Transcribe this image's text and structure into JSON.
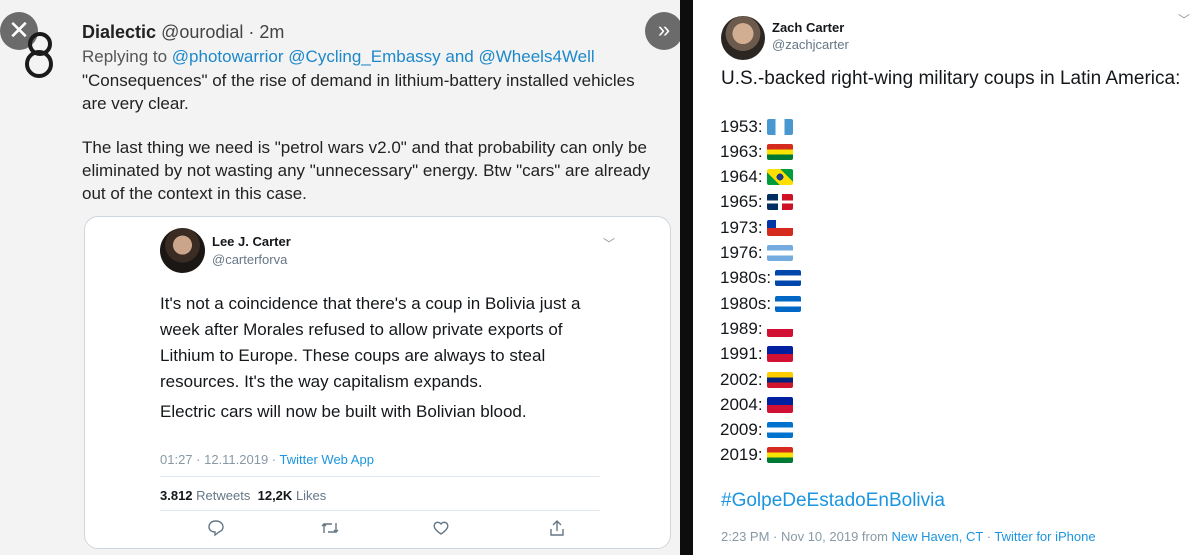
{
  "left_tweet": {
    "author_name": "Dialectic",
    "author_handle": "@ourodial",
    "separator": "·",
    "time_ago": "2m",
    "replying_prefix": "Replying to",
    "reply_handle_1": "@photowarrior",
    "reply_handle_2": "@Cycling_Embassy",
    "reply_and": "and",
    "reply_handle_3": "@Wheels4Well",
    "text_lines": [
      "\"Consequences\" of the rise of demand in lithium-battery installed vehicles",
      "are very clear.",
      "The last thing we need is \"petrol wars v2.0\" and that probability can only be",
      "eliminated by not wasting any \"unnecessary\" energy. Btw \"cars\" are already",
      "out of the context in this case."
    ],
    "close_icon": "close-icon",
    "next_icon": "double-chevron-right-icon"
  },
  "quoted_tweet": {
    "author_name": "Lee J. Carter",
    "author_handle": "@carterforva",
    "text_lines": [
      "It's not a coincidence that there's a coup in Bolivia just a",
      "week after Morales refused to allow private exports of",
      "Lithium to Europe.  These coups are always to steal",
      "resources.  It's the way capitalism expands.",
      "Electric cars will now be built with Bolivian blood."
    ],
    "timestamp": "01:27 · 12.11.2019 ·",
    "source": "Twitter Web App",
    "retweets_count": "3.812",
    "retweets_label": "Retweets",
    "likes_count": "12,2K",
    "likes_label": "Likes",
    "actions": [
      "reply-icon",
      "retweet-icon",
      "like-icon",
      "share-icon"
    ]
  },
  "right_tweet": {
    "author_name": "Zach Carter",
    "author_handle": "@zachjcarter",
    "title": "U.S.-backed right-wing military coups in Latin America:",
    "coups": [
      {
        "year": "1953:",
        "flag": "guatemala"
      },
      {
        "year": "1963:",
        "flag": "bolivia"
      },
      {
        "year": "1964:",
        "flag": "brazil"
      },
      {
        "year": "1965:",
        "flag": "dominican-republic"
      },
      {
        "year": "1973:",
        "flag": "chile"
      },
      {
        "year": "1976:",
        "flag": "argentina"
      },
      {
        "year": "1980s:",
        "flag": "el-salvador"
      },
      {
        "year": "1980s:",
        "flag": "nicaragua"
      },
      {
        "year": "1989:",
        "flag": "panama"
      },
      {
        "year": "1991:",
        "flag": "haiti"
      },
      {
        "year": "2002:",
        "flag": "venezuela"
      },
      {
        "year": "2004:",
        "flag": "haiti"
      },
      {
        "year": "2009:",
        "flag": "honduras"
      },
      {
        "year": "2019:",
        "flag": "bolivia"
      }
    ],
    "hashtag": "#GolpeDeEstadoEnBolivia",
    "timestamp": "2:23 PM · Nov 10, 2019 from",
    "location": "New Haven, CT",
    "source_sep": "·",
    "source": "Twitter for iPhone"
  },
  "colors": {
    "link": "#1b95e0",
    "left_background": "#f3f3f3",
    "divider": "#0d0d0d"
  }
}
